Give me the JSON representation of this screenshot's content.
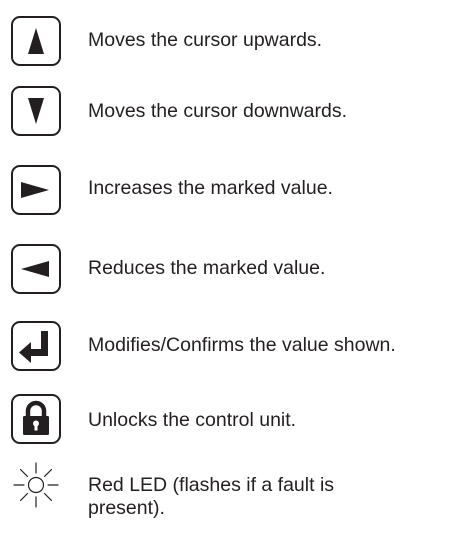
{
  "legend": {
    "items": [
      {
        "icon": "arrow-up-key-icon",
        "text": "Moves the cursor upwards."
      },
      {
        "icon": "arrow-down-key-icon",
        "text": "Moves the cursor downwards."
      },
      {
        "icon": "arrow-right-key-icon",
        "text": "Increases the marked value."
      },
      {
        "icon": "arrow-left-key-icon",
        "text": "Reduces the marked value."
      },
      {
        "icon": "enter-key-icon",
        "text": "Modifies/Confirms the value shown."
      },
      {
        "icon": "padlock-key-icon",
        "text": "Unlocks the control unit."
      },
      {
        "icon": "red-led-icon",
        "text_line1": "Red LED (flashes if a fault is",
        "text_line2": "present)."
      }
    ]
  },
  "colors": {
    "ink": "#231f20",
    "background": "#ffffff"
  }
}
